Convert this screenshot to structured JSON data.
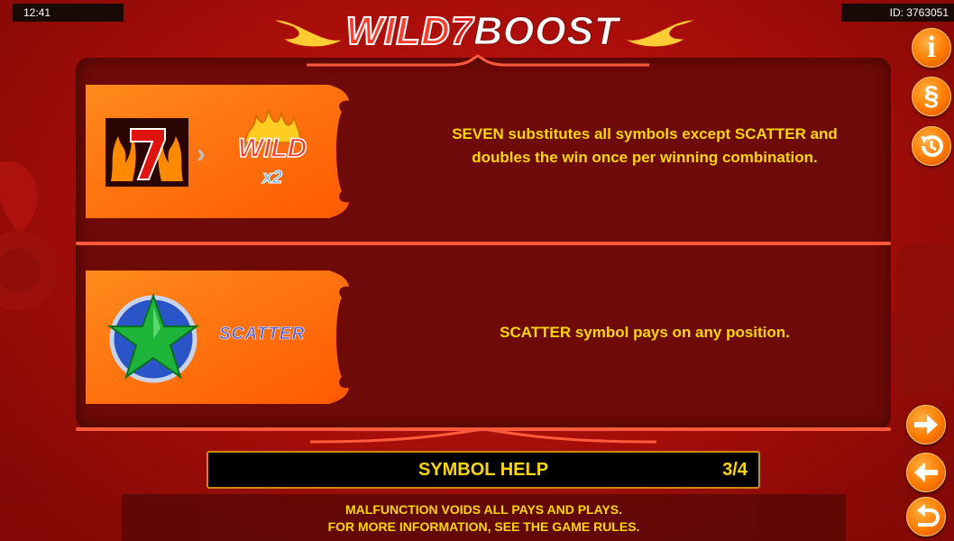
{
  "status": {
    "clock": "12:41",
    "game_id": "ID: 3763051"
  },
  "logo": {
    "part1": "WILD",
    "part2": "7",
    "part3": "BOOST"
  },
  "symbols": [
    {
      "name": "seven-wild",
      "badge_label": "WILD",
      "multiplier": "x2",
      "description": "SEVEN substitutes all symbols except SCATTER and doubles the win once per winning combination."
    },
    {
      "name": "scatter",
      "badge_label": "SCATTER",
      "description": "SCATTER symbol pays on any position."
    }
  ],
  "help_bar": {
    "title": "SYMBOL HELP",
    "page": "3/4"
  },
  "notice": {
    "line1": "MALFUNCTION VOIDS ALL PAYS AND PLAYS.",
    "line2": "FOR MORE INFORMATION, SEE THE GAME RULES."
  },
  "buttons": {
    "info_glyph": "i",
    "paytable_glyph": "§"
  },
  "colors": {
    "accent_text": "#ffd700",
    "background": "#a70f0b",
    "panel": "#6e0a07",
    "button": "#ff7a00"
  },
  "icons": [
    "info-icon",
    "paragraph-icon",
    "history-icon",
    "arrow-right-icon",
    "arrow-left-icon",
    "return-icon"
  ]
}
